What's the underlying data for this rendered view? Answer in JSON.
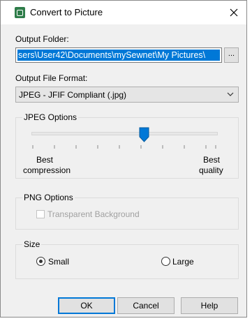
{
  "window": {
    "title": "Convert to Picture",
    "icon": "mysewnet-app-icon",
    "close_icon": "close-icon"
  },
  "output_folder": {
    "label": "Output Folder:",
    "value": "sers\\User42\\Documents\\mySewnet\\My Pictures\\",
    "browse_label": "..."
  },
  "output_format": {
    "label": "Output File Format:",
    "selected": "JPEG - JFIF Compliant (.jpg)"
  },
  "jpeg_options": {
    "title": "JPEG Options",
    "slider_left_label_line1": "Best",
    "slider_left_label_line2": "compression",
    "slider_right_label_line1": "Best",
    "slider_right_label_line2": "quality",
    "slider_position": 0.62
  },
  "png_options": {
    "title": "PNG Options",
    "transparent_label": "Transparent Background",
    "transparent_checked": false,
    "enabled": false
  },
  "size": {
    "title": "Size",
    "small_label": "Small",
    "large_label": "Large",
    "selected": "Small"
  },
  "buttons": {
    "ok": "OK",
    "cancel": "Cancel",
    "help": "Help"
  },
  "colors": {
    "selection": "#0078d7",
    "dialog_bg": "#f0f0f0",
    "disabled_text": "#a0a0a0"
  }
}
